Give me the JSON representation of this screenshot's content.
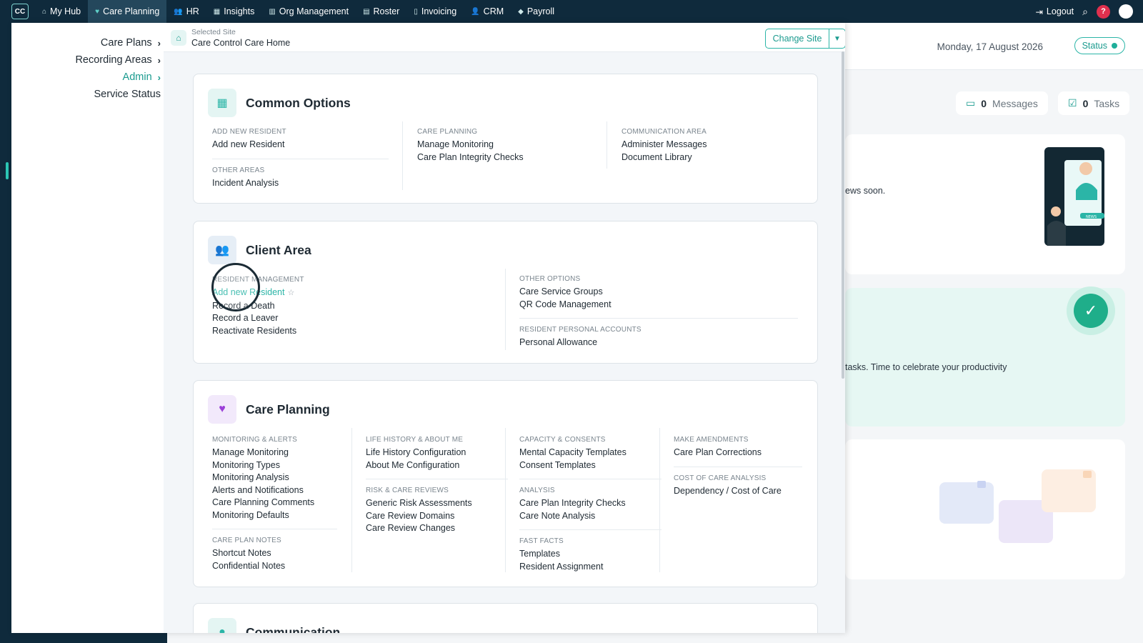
{
  "topnav": {
    "logo": "CC",
    "items": [
      {
        "label": "My Hub",
        "icon": "home-icon",
        "glyph": "⌂"
      },
      {
        "label": "Care Planning",
        "icon": "heart-icon",
        "glyph": "♥"
      },
      {
        "label": "HR",
        "icon": "people-icon",
        "glyph": "👥"
      },
      {
        "label": "Insights",
        "icon": "chart-icon",
        "glyph": "▦"
      },
      {
        "label": "Org Management",
        "icon": "building-icon",
        "glyph": "▥"
      },
      {
        "label": "Roster",
        "icon": "calendar-icon",
        "glyph": "▤"
      },
      {
        "label": "Invoicing",
        "icon": "invoice-icon",
        "glyph": "▯"
      },
      {
        "label": "CRM",
        "icon": "crm-icon",
        "glyph": "👤"
      },
      {
        "label": "Payroll",
        "icon": "payroll-icon",
        "glyph": "◆"
      }
    ],
    "logout": "Logout",
    "help": "?"
  },
  "dashboard": {
    "date": "Monday, 17 August 2026",
    "status": "Status",
    "messages_count": "0",
    "messages_label": "Messages",
    "tasks_count": "0",
    "tasks_label": "Tasks",
    "news_text": "ews soon.",
    "tasks_text": "tasks. Time to celebrate your productivity",
    "news_badge": "NEWS"
  },
  "sidebar": {
    "items": [
      {
        "label": "Care Plans",
        "has_chevron": true
      },
      {
        "label": "Recording Areas",
        "has_chevron": true
      },
      {
        "label": "Admin",
        "has_chevron": true,
        "active": true
      },
      {
        "label": "Service Status",
        "has_chevron": false
      }
    ]
  },
  "site": {
    "label": "Selected Site",
    "name": "Care Control Care Home",
    "change_label": "Change Site"
  },
  "sections": {
    "common": {
      "title": "Common Options",
      "col1": [
        {
          "title": "ADD NEW RESIDENT",
          "links": [
            "Add new Resident"
          ]
        },
        {
          "title": "OTHER AREAS",
          "links": [
            "Incident Analysis"
          ]
        }
      ],
      "col2": [
        {
          "title": "CARE PLANNING",
          "links": [
            "Manage Monitoring",
            "Care Plan Integrity Checks"
          ]
        }
      ],
      "col3": [
        {
          "title": "COMMUNICATION AREA",
          "links": [
            "Administer Messages",
            "Document Library"
          ]
        }
      ]
    },
    "client": {
      "title": "Client Area",
      "col1": [
        {
          "title": "RESIDENT MANAGEMENT",
          "links": [
            "Add new Resident",
            "Record a Death",
            "Record a Leaver",
            "Reactivate Residents"
          ]
        }
      ],
      "col2": [
        {
          "title": "OTHER OPTIONS",
          "links": [
            "Care Service Groups",
            "QR Code Management"
          ]
        },
        {
          "title": "RESIDENT PERSONAL ACCOUNTS",
          "links": [
            "Personal Allowance"
          ]
        }
      ]
    },
    "care": {
      "title": "Care Planning",
      "col1": [
        {
          "title": "MONITORING & ALERTS",
          "links": [
            "Manage Monitoring",
            "Monitoring Types",
            "Monitoring Analysis",
            "Alerts and Notifications",
            "Care Planning Comments",
            "Monitoring Defaults"
          ]
        },
        {
          "title": "CARE PLAN NOTES",
          "links": [
            "Shortcut Notes",
            "Confidential Notes"
          ]
        }
      ],
      "col2": [
        {
          "title": "LIFE HISTORY & ABOUT ME",
          "links": [
            "Life History Configuration",
            "About Me Configuration"
          ]
        },
        {
          "title": "RISK & CARE REVIEWS",
          "links": [
            "Generic Risk Assessments",
            "Care Review Domains",
            "Care Review Changes"
          ]
        }
      ],
      "col3": [
        {
          "title": "CAPACITY & CONSENTS",
          "links": [
            "Mental Capacity Templates",
            "Consent Templates"
          ]
        },
        {
          "title": "ANALYSIS",
          "links": [
            "Care Plan Integrity Checks",
            "Care Note Analysis"
          ]
        },
        {
          "title": "FAST FACTS",
          "links": [
            "Templates",
            "Resident Assignment"
          ]
        }
      ],
      "col4": [
        {
          "title": "MAKE AMENDMENTS",
          "links": [
            "Care Plan Corrections"
          ]
        },
        {
          "title": "COST OF CARE ANALYSIS",
          "links": [
            "Dependency / Cost of Care"
          ]
        }
      ]
    },
    "communication": {
      "title": "Communication"
    }
  },
  "colors": {
    "nav_bg": "#0f2a3c",
    "accent": "#2bb5a7",
    "care_icon": "#9b3fd8"
  }
}
